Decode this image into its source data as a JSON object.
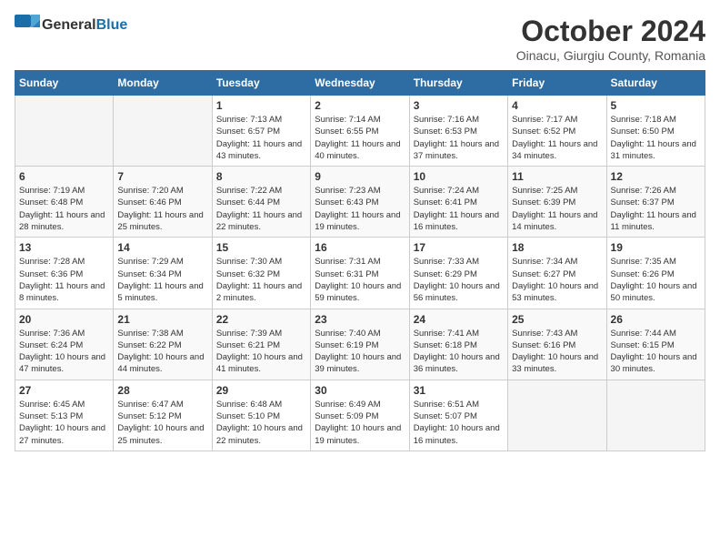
{
  "header": {
    "logo_general": "General",
    "logo_blue": "Blue",
    "month_title": "October 2024",
    "location": "Oinacu, Giurgiu County, Romania"
  },
  "weekdays": [
    "Sunday",
    "Monday",
    "Tuesday",
    "Wednesday",
    "Thursday",
    "Friday",
    "Saturday"
  ],
  "weeks": [
    [
      {
        "day": "",
        "sunrise": "",
        "sunset": "",
        "daylight": ""
      },
      {
        "day": "",
        "sunrise": "",
        "sunset": "",
        "daylight": ""
      },
      {
        "day": "1",
        "sunrise": "Sunrise: 7:13 AM",
        "sunset": "Sunset: 6:57 PM",
        "daylight": "Daylight: 11 hours and 43 minutes."
      },
      {
        "day": "2",
        "sunrise": "Sunrise: 7:14 AM",
        "sunset": "Sunset: 6:55 PM",
        "daylight": "Daylight: 11 hours and 40 minutes."
      },
      {
        "day": "3",
        "sunrise": "Sunrise: 7:16 AM",
        "sunset": "Sunset: 6:53 PM",
        "daylight": "Daylight: 11 hours and 37 minutes."
      },
      {
        "day": "4",
        "sunrise": "Sunrise: 7:17 AM",
        "sunset": "Sunset: 6:52 PM",
        "daylight": "Daylight: 11 hours and 34 minutes."
      },
      {
        "day": "5",
        "sunrise": "Sunrise: 7:18 AM",
        "sunset": "Sunset: 6:50 PM",
        "daylight": "Daylight: 11 hours and 31 minutes."
      }
    ],
    [
      {
        "day": "6",
        "sunrise": "Sunrise: 7:19 AM",
        "sunset": "Sunset: 6:48 PM",
        "daylight": "Daylight: 11 hours and 28 minutes."
      },
      {
        "day": "7",
        "sunrise": "Sunrise: 7:20 AM",
        "sunset": "Sunset: 6:46 PM",
        "daylight": "Daylight: 11 hours and 25 minutes."
      },
      {
        "day": "8",
        "sunrise": "Sunrise: 7:22 AM",
        "sunset": "Sunset: 6:44 PM",
        "daylight": "Daylight: 11 hours and 22 minutes."
      },
      {
        "day": "9",
        "sunrise": "Sunrise: 7:23 AM",
        "sunset": "Sunset: 6:43 PM",
        "daylight": "Daylight: 11 hours and 19 minutes."
      },
      {
        "day": "10",
        "sunrise": "Sunrise: 7:24 AM",
        "sunset": "Sunset: 6:41 PM",
        "daylight": "Daylight: 11 hours and 16 minutes."
      },
      {
        "day": "11",
        "sunrise": "Sunrise: 7:25 AM",
        "sunset": "Sunset: 6:39 PM",
        "daylight": "Daylight: 11 hours and 14 minutes."
      },
      {
        "day": "12",
        "sunrise": "Sunrise: 7:26 AM",
        "sunset": "Sunset: 6:37 PM",
        "daylight": "Daylight: 11 hours and 11 minutes."
      }
    ],
    [
      {
        "day": "13",
        "sunrise": "Sunrise: 7:28 AM",
        "sunset": "Sunset: 6:36 PM",
        "daylight": "Daylight: 11 hours and 8 minutes."
      },
      {
        "day": "14",
        "sunrise": "Sunrise: 7:29 AM",
        "sunset": "Sunset: 6:34 PM",
        "daylight": "Daylight: 11 hours and 5 minutes."
      },
      {
        "day": "15",
        "sunrise": "Sunrise: 7:30 AM",
        "sunset": "Sunset: 6:32 PM",
        "daylight": "Daylight: 11 hours and 2 minutes."
      },
      {
        "day": "16",
        "sunrise": "Sunrise: 7:31 AM",
        "sunset": "Sunset: 6:31 PM",
        "daylight": "Daylight: 10 hours and 59 minutes."
      },
      {
        "day": "17",
        "sunrise": "Sunrise: 7:33 AM",
        "sunset": "Sunset: 6:29 PM",
        "daylight": "Daylight: 10 hours and 56 minutes."
      },
      {
        "day": "18",
        "sunrise": "Sunrise: 7:34 AM",
        "sunset": "Sunset: 6:27 PM",
        "daylight": "Daylight: 10 hours and 53 minutes."
      },
      {
        "day": "19",
        "sunrise": "Sunrise: 7:35 AM",
        "sunset": "Sunset: 6:26 PM",
        "daylight": "Daylight: 10 hours and 50 minutes."
      }
    ],
    [
      {
        "day": "20",
        "sunrise": "Sunrise: 7:36 AM",
        "sunset": "Sunset: 6:24 PM",
        "daylight": "Daylight: 10 hours and 47 minutes."
      },
      {
        "day": "21",
        "sunrise": "Sunrise: 7:38 AM",
        "sunset": "Sunset: 6:22 PM",
        "daylight": "Daylight: 10 hours and 44 minutes."
      },
      {
        "day": "22",
        "sunrise": "Sunrise: 7:39 AM",
        "sunset": "Sunset: 6:21 PM",
        "daylight": "Daylight: 10 hours and 41 minutes."
      },
      {
        "day": "23",
        "sunrise": "Sunrise: 7:40 AM",
        "sunset": "Sunset: 6:19 PM",
        "daylight": "Daylight: 10 hours and 39 minutes."
      },
      {
        "day": "24",
        "sunrise": "Sunrise: 7:41 AM",
        "sunset": "Sunset: 6:18 PM",
        "daylight": "Daylight: 10 hours and 36 minutes."
      },
      {
        "day": "25",
        "sunrise": "Sunrise: 7:43 AM",
        "sunset": "Sunset: 6:16 PM",
        "daylight": "Daylight: 10 hours and 33 minutes."
      },
      {
        "day": "26",
        "sunrise": "Sunrise: 7:44 AM",
        "sunset": "Sunset: 6:15 PM",
        "daylight": "Daylight: 10 hours and 30 minutes."
      }
    ],
    [
      {
        "day": "27",
        "sunrise": "Sunrise: 6:45 AM",
        "sunset": "Sunset: 5:13 PM",
        "daylight": "Daylight: 10 hours and 27 minutes."
      },
      {
        "day": "28",
        "sunrise": "Sunrise: 6:47 AM",
        "sunset": "Sunset: 5:12 PM",
        "daylight": "Daylight: 10 hours and 25 minutes."
      },
      {
        "day": "29",
        "sunrise": "Sunrise: 6:48 AM",
        "sunset": "Sunset: 5:10 PM",
        "daylight": "Daylight: 10 hours and 22 minutes."
      },
      {
        "day": "30",
        "sunrise": "Sunrise: 6:49 AM",
        "sunset": "Sunset: 5:09 PM",
        "daylight": "Daylight: 10 hours and 19 minutes."
      },
      {
        "day": "31",
        "sunrise": "Sunrise: 6:51 AM",
        "sunset": "Sunset: 5:07 PM",
        "daylight": "Daylight: 10 hours and 16 minutes."
      },
      {
        "day": "",
        "sunrise": "",
        "sunset": "",
        "daylight": ""
      },
      {
        "day": "",
        "sunrise": "",
        "sunset": "",
        "daylight": ""
      }
    ]
  ]
}
